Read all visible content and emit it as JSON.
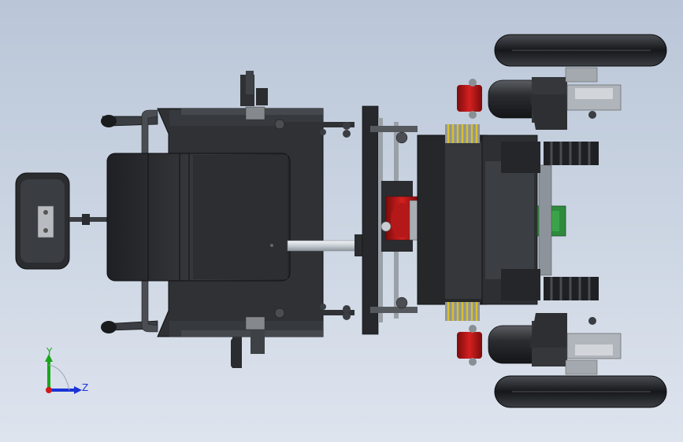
{
  "viewport": {
    "background_top": "#bac6d8",
    "background_bottom": "#dee4ee"
  },
  "triad": {
    "y_label": "Y",
    "z_label": "Z",
    "y_color": "#1aa51a",
    "z_color": "#1a33d6",
    "x_color": "#d21a1a"
  },
  "model": {
    "body_color": "#2b2d30",
    "accent_red": "#c21414",
    "spring_yellow": "#d9c02a",
    "steel": "#9ea4ab",
    "green_part": "#2f8a3d"
  }
}
